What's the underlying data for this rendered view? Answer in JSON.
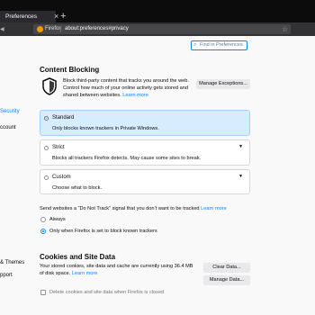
{
  "browser": {
    "tab_title": "Preferences",
    "tab_close": "×",
    "new_tab": "+",
    "identity_label": "Firefox",
    "url": "about:preferences#privacy"
  },
  "sidebar": {
    "items": [
      "Security",
      "ccount",
      "& Themes",
      "pport"
    ]
  },
  "search": {
    "placeholder": "Find in Preferences"
  },
  "content_blocking": {
    "heading": "Content Blocking",
    "description": "Block third-party content that tracks you around the web. Control how much of your online activity gets stored and shared between websites.",
    "learn_more": "Learn more",
    "manage_exceptions": "Manage Exceptions...",
    "options": [
      {
        "title": "Standard",
        "subtitle": "Only blocks known trackers in Private Windows.",
        "selected": true
      },
      {
        "title": "Strict",
        "subtitle": "Blocks all trackers Firefox detects. May cause some sites to break.",
        "selected": false
      },
      {
        "title": "Custom",
        "subtitle": "Choose what to block.",
        "selected": false
      }
    ]
  },
  "dnt": {
    "prompt": "Send websites a “Do Not Track” signal that you don’t want to be tracked",
    "learn_more": "Learn more",
    "options": [
      {
        "label": "Always",
        "selected": false
      },
      {
        "label": "Only when Firefox is set to block known trackers",
        "selected": true
      }
    ]
  },
  "cookies": {
    "heading": "Cookies and Site Data",
    "usage_text": "Your stored cookies, site data and cache are currently using 36.4 MB of disk space.",
    "learn_more": "Learn more",
    "clear_data": "Clear Data...",
    "manage_data": "Manage Data...",
    "delete_on_close": "Delete cookies and site data when Firefox is closed"
  },
  "colors": {
    "accent": "#0a84ff",
    "selected_bg": "#d6ecff",
    "chrome_dark": "#0c0c0d"
  }
}
